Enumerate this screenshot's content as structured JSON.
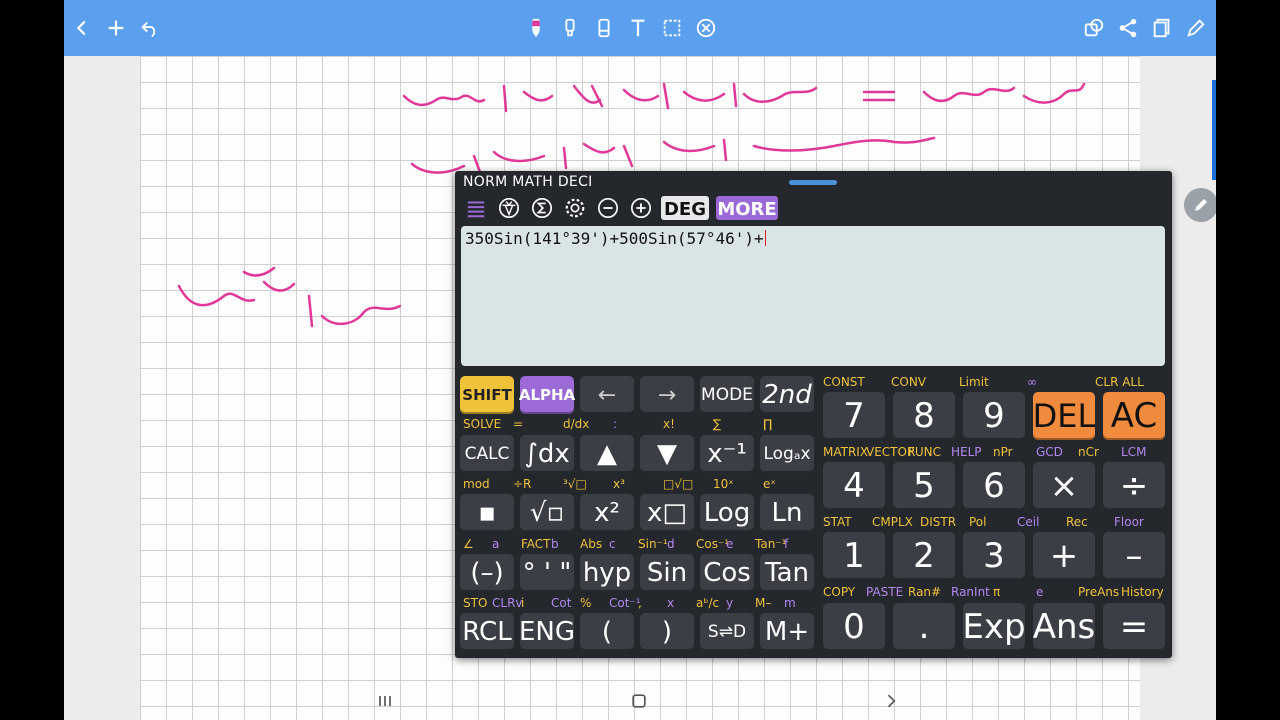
{
  "calculator": {
    "title": "NORM MATH DECI",
    "angle_mode": "DEG",
    "more_label": "MORE",
    "expression": "350Sin(141°39')+500Sin(57°46')+",
    "left_keys": [
      {
        "name": "shift-key",
        "label": "SHIFT",
        "cls": "shift"
      },
      {
        "name": "alpha-key",
        "label": "ALPHA",
        "cls": "alpha"
      },
      {
        "name": "left-arrow-key",
        "label": "←",
        "cls": "arrow"
      },
      {
        "name": "right-arrow-key",
        "label": "→",
        "cls": "arrow"
      },
      {
        "name": "mode-key",
        "label": "MODE",
        "cls": "small"
      },
      {
        "name": "second-function-key",
        "label": "2nd",
        "cls": "italic"
      },
      {
        "name": "calc-key",
        "label": "CALC",
        "cls": "small"
      },
      {
        "name": "integral-key",
        "label": "∫dx",
        "cls": ""
      },
      {
        "name": "up-arrow-key",
        "label": "▲",
        "cls": ""
      },
      {
        "name": "down-arrow-key",
        "label": "▼",
        "cls": ""
      },
      {
        "name": "reciprocal-key",
        "label": "x⁻¹",
        "cls": ""
      },
      {
        "name": "log-base-key",
        "label": "Logₐx",
        "cls": "small"
      },
      {
        "name": "fraction-key",
        "label": "▪",
        "cls": ""
      },
      {
        "name": "sqrt-key",
        "label": "√▫",
        "cls": ""
      },
      {
        "name": "square-key",
        "label": "x²",
        "cls": ""
      },
      {
        "name": "power-key",
        "label": "x□",
        "cls": ""
      },
      {
        "name": "log-key",
        "label": "Log",
        "cls": ""
      },
      {
        "name": "ln-key",
        "label": "Ln",
        "cls": ""
      },
      {
        "name": "negative-key",
        "label": "(–)",
        "cls": ""
      },
      {
        "name": "degree-key",
        "label": "° ' \"",
        "cls": ""
      },
      {
        "name": "hyp-key",
        "label": "hyp",
        "cls": ""
      },
      {
        "name": "sin-key",
        "label": "Sin",
        "cls": ""
      },
      {
        "name": "cos-key",
        "label": "Cos",
        "cls": ""
      },
      {
        "name": "tan-key",
        "label": "Tan",
        "cls": ""
      },
      {
        "name": "rcl-key",
        "label": "RCL",
        "cls": ""
      },
      {
        "name": "eng-key",
        "label": "ENG",
        "cls": ""
      },
      {
        "name": "open-paren-key",
        "label": "(",
        "cls": ""
      },
      {
        "name": "close-paren-key",
        "label": ")",
        "cls": ""
      },
      {
        "name": "s-to-d-key",
        "label": "S⇌D",
        "cls": "small"
      },
      {
        "name": "m-plus-key",
        "label": "M+",
        "cls": ""
      }
    ],
    "left_labels": [
      [
        {
          "t": "SOLVE",
          "c": "y"
        },
        {
          "t": "=",
          "c": "y"
        },
        {
          "t": "d/dx",
          "c": "y"
        },
        {
          "t": ":",
          "c": "p"
        },
        {
          "t": "x!",
          "c": "y"
        },
        {
          "t": "∑",
          "c": "y"
        },
        {
          "t": "∏",
          "c": "y"
        }
      ],
      [
        {
          "t": "mod",
          "c": "y"
        },
        {
          "t": "÷R",
          "c": "y"
        },
        {
          "t": "³√□",
          "c": "y"
        },
        {
          "t": "x³",
          "c": "y"
        },
        {
          "t": "□√□",
          "c": "y"
        },
        {
          "t": "10ˣ",
          "c": "y"
        },
        {
          "t": "eˣ",
          "c": "y"
        }
      ],
      [
        {
          "t": "∠",
          "c": "y"
        },
        {
          "t": "a",
          "c": "p"
        },
        {
          "t": "FACT",
          "c": "y"
        },
        {
          "t": "b",
          "c": "p"
        },
        {
          "t": "Abs",
          "c": "y"
        },
        {
          "t": "c",
          "c": "p"
        },
        {
          "t": "Sin⁻¹",
          "c": "y"
        },
        {
          "t": "d",
          "c": "p"
        },
        {
          "t": "Cos⁻¹",
          "c": "y"
        },
        {
          "t": "e",
          "c": "p"
        },
        {
          "t": "Tan⁻¹",
          "c": "y"
        },
        {
          "t": "f",
          "c": "p"
        }
      ],
      [
        {
          "t": "STO",
          "c": "y"
        },
        {
          "t": "CLRv",
          "c": "p"
        },
        {
          "t": "i",
          "c": "y"
        },
        {
          "t": "Cot",
          "c": "p"
        },
        {
          "t": "%",
          "c": "y"
        },
        {
          "t": "Cot⁻¹",
          "c": "p"
        },
        {
          "t": ",",
          "c": "y"
        },
        {
          "t": "x",
          "c": "p"
        },
        {
          "t": "aᵇ/c",
          "c": "y"
        },
        {
          "t": "y",
          "c": "p"
        },
        {
          "t": "M–",
          "c": "y"
        },
        {
          "t": "m",
          "c": "p"
        }
      ]
    ],
    "right_keys": [
      {
        "name": "key-7",
        "label": "7",
        "cls": "num"
      },
      {
        "name": "key-8",
        "label": "8",
        "cls": "num"
      },
      {
        "name": "key-9",
        "label": "9",
        "cls": "num"
      },
      {
        "name": "del-key",
        "label": "DEL",
        "cls": "del"
      },
      {
        "name": "ac-key",
        "label": "AC",
        "cls": "ac"
      },
      {
        "name": "key-4",
        "label": "4",
        "cls": "num"
      },
      {
        "name": "key-5",
        "label": "5",
        "cls": "num"
      },
      {
        "name": "key-6",
        "label": "6",
        "cls": "num"
      },
      {
        "name": "multiply-key",
        "label": "×",
        "cls": "num"
      },
      {
        "name": "divide-key",
        "label": "÷",
        "cls": "num"
      },
      {
        "name": "key-1",
        "label": "1",
        "cls": "num"
      },
      {
        "name": "key-2",
        "label": "2",
        "cls": "num"
      },
      {
        "name": "key-3",
        "label": "3",
        "cls": "num"
      },
      {
        "name": "plus-key",
        "label": "+",
        "cls": "num"
      },
      {
        "name": "minus-key",
        "label": "–",
        "cls": "num"
      },
      {
        "name": "key-0",
        "label": "0",
        "cls": "num"
      },
      {
        "name": "decimal-key",
        "label": ".",
        "cls": "num"
      },
      {
        "name": "exp-key",
        "label": "Exp",
        "cls": "num"
      },
      {
        "name": "ans-key",
        "label": "Ans",
        "cls": "num"
      },
      {
        "name": "equals-key",
        "label": "=",
        "cls": "num"
      }
    ],
    "right_labels": [
      [
        {
          "t": "CONST",
          "c": "y"
        },
        {
          "t": "CONV",
          "c": "y"
        },
        {
          "t": "Limit",
          "c": "y"
        },
        {
          "t": "∞",
          "c": "p"
        },
        {
          "t": "CLR ALL",
          "c": "y"
        }
      ],
      [
        {
          "t": "MATRIX",
          "c": "y"
        },
        {
          "t": "VECTOR",
          "c": "y"
        },
        {
          "t": "FUNC",
          "c": "y"
        },
        {
          "t": "HELP",
          "c": "p"
        },
        {
          "t": "nPr",
          "c": "y"
        },
        {
          "t": "GCD",
          "c": "p"
        },
        {
          "t": "nCr",
          "c": "y"
        },
        {
          "t": "LCM",
          "c": "p"
        }
      ],
      [
        {
          "t": "STAT",
          "c": "y"
        },
        {
          "t": "CMPLX",
          "c": "y"
        },
        {
          "t": "DISTR",
          "c": "y"
        },
        {
          "t": "Pol",
          "c": "y"
        },
        {
          "t": "Ceil",
          "c": "p"
        },
        {
          "t": "Rec",
          "c": "y"
        },
        {
          "t": "Floor",
          "c": "p"
        }
      ],
      [
        {
          "t": "COPY",
          "c": "y"
        },
        {
          "t": "PASTE",
          "c": "p"
        },
        {
          "t": "Ran#",
          "c": "y"
        },
        {
          "t": "RanInt",
          "c": "p"
        },
        {
          "t": "π",
          "c": "y"
        },
        {
          "t": "e",
          "c": "p"
        },
        {
          "t": "PreAns",
          "c": "y"
        },
        {
          "t": "History",
          "c": "y"
        }
      ]
    ]
  },
  "colors": {
    "toolbar": "#5aa0ee",
    "ink": "#e0389a",
    "shift": "#f0c23a",
    "alpha": "#9b6ad6",
    "del": "#f08a3c"
  }
}
